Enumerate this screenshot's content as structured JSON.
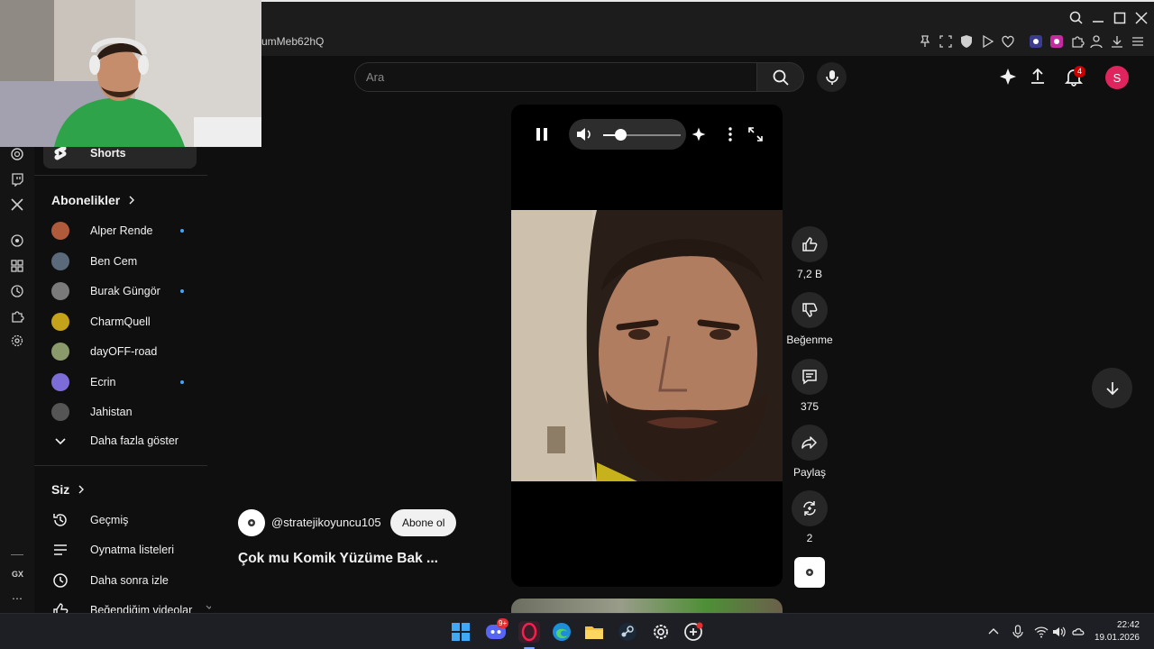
{
  "browser": {
    "url_fragment": "umMeb62hQ"
  },
  "header": {
    "search_placeholder": "Ara",
    "notification_count": "4",
    "account_initial": "S"
  },
  "sidebar": {
    "shorts_label": "Shorts",
    "subscriptions_heading": "Abonelikler",
    "subscriptions": [
      {
        "name": "Alper Rende",
        "new": true,
        "color": "#b05a3c"
      },
      {
        "name": "Ben Cem",
        "new": false,
        "color": "#5a6a7a"
      },
      {
        "name": "Burak Güngör",
        "new": true,
        "color": "#7a7a7a"
      },
      {
        "name": "CharmQuell",
        "new": false,
        "color": "#c4a21a"
      },
      {
        "name": "dayOFF-road",
        "new": false,
        "color": "#8a9a6a"
      },
      {
        "name": "Ecrin",
        "new": true,
        "color": "#7c6cd8"
      },
      {
        "name": "Jahistan",
        "new": false,
        "color": "#555555"
      }
    ],
    "show_more": "Daha fazla göster",
    "you_heading": "Siz",
    "you_items": [
      {
        "label": "Geçmiş",
        "icon": "history-icon"
      },
      {
        "label": "Oynatma listeleri",
        "icon": "playlist-icon"
      },
      {
        "label": "Daha sonra izle",
        "icon": "watch-later-icon"
      },
      {
        "label": "Beğendiğim videolar",
        "icon": "liked-icon"
      }
    ]
  },
  "rail": {
    "bottom_label": "GX"
  },
  "player": {
    "volume": 0.22
  },
  "video": {
    "channel": "@stratejikoyuncu105",
    "subscribe_label": "Abone ol",
    "title": "Çok mu Komik Yüzüme Bak ..."
  },
  "actions": {
    "likes": "7,2 B",
    "dislike_label": "Beğenme",
    "comments": "375",
    "share_label": "Paylaş",
    "remix_count": "2"
  },
  "taskbar": {
    "discord_badge": "9+",
    "time": "22:42",
    "date": "19.01.2026"
  },
  "colors": {
    "accent_red": "#cc0000",
    "account": "#e0245e",
    "new_dot": "#3ea6ff"
  }
}
